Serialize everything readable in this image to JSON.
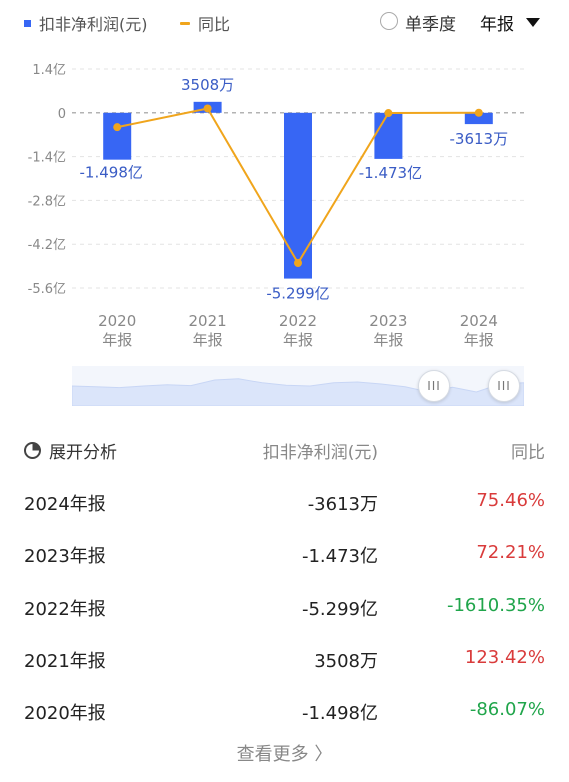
{
  "legend": {
    "bar_label": "扣非净利润(元)",
    "line_label": "同比"
  },
  "controls": {
    "quarter_option": "单季度",
    "period_selected": "年报"
  },
  "colors": {
    "bar": "#3766f4",
    "line": "#f0a51c",
    "positive": "#d93b3b",
    "negative": "#20a54b",
    "grid": "#e3e3e3",
    "axis_text": "#888888",
    "value_label": "#3a5cc5"
  },
  "chart_data": {
    "type": "bar",
    "categories": [
      "2020\n年报",
      "2021\n年报",
      "2022\n年报",
      "2023\n年报",
      "2024\n年报"
    ],
    "series": [
      {
        "type": "bar",
        "unit": "亿元",
        "values": [
          -1.498,
          0.3508,
          -5.299,
          -1.473,
          -0.3613
        ],
        "labels": [
          "-1.498亿",
          "3508万",
          "-5.299亿",
          "-1.473亿",
          "-3613万"
        ]
      },
      {
        "type": "line",
        "unit": "%",
        "values": [
          -86.07,
          123.42,
          -1610.35,
          72.21,
          75.46
        ]
      }
    ],
    "y_ticks": [
      "1.4亿",
      "0",
      "-1.4亿",
      "-2.8亿",
      "-4.2亿",
      "-5.6亿"
    ],
    "ylim": [
      -5.6,
      1.4
    ],
    "grid": true
  },
  "table": {
    "expand_label": "展开分析",
    "col_value": "扣非净利润(元)",
    "col_yoy": "同比",
    "rows": [
      {
        "period": "2024年报",
        "value": "-3613万",
        "yoy": "75.46%",
        "sign": "pos"
      },
      {
        "period": "2023年报",
        "value": "-1.473亿",
        "yoy": "72.21%",
        "sign": "pos"
      },
      {
        "period": "2022年报",
        "value": "-5.299亿",
        "yoy": "-1610.35%",
        "sign": "neg"
      },
      {
        "period": "2021年报",
        "value": "3508万",
        "yoy": "123.42%",
        "sign": "pos"
      },
      {
        "period": "2020年报",
        "value": "-1.498亿",
        "yoy": "-86.07%",
        "sign": "neg"
      }
    ],
    "more_label": "查看更多 〉"
  }
}
